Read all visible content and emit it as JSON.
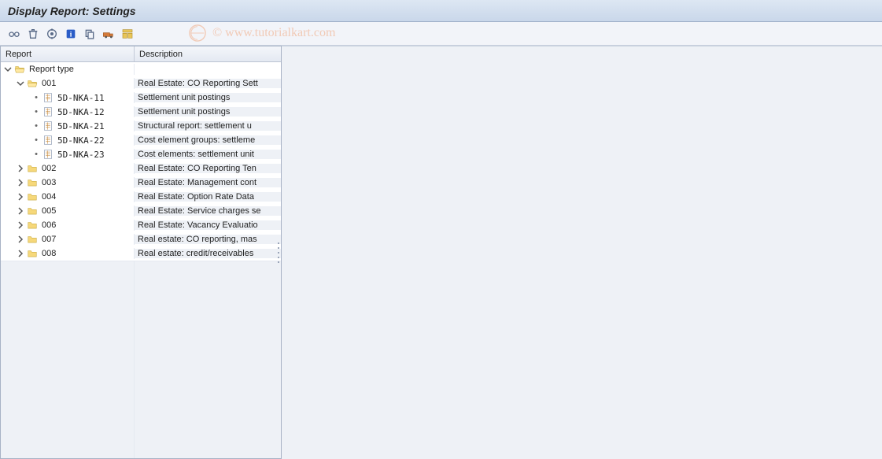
{
  "window": {
    "title": "Display Report: Settings"
  },
  "toolbar": {
    "items": [
      {
        "name": "glasses-icon",
        "title": "Display"
      },
      {
        "name": "trash-icon",
        "title": "Delete"
      },
      {
        "name": "execute-icon",
        "title": "Execute"
      },
      {
        "name": "info-icon",
        "title": "Information"
      },
      {
        "name": "copy-icon",
        "title": "Copy"
      },
      {
        "name": "transport-icon",
        "title": "Transport"
      },
      {
        "name": "layout-icon",
        "title": "Layout"
      }
    ]
  },
  "watermark": "© www.tutorialkart.com",
  "tree": {
    "cols": {
      "report": "Report",
      "description": "Description"
    },
    "root": {
      "label": "Report type",
      "desc": ""
    },
    "n001": {
      "label": "001",
      "desc": "Real Estate: CO Reporting Sett"
    },
    "leaves": [
      {
        "label": "5D-NKA-11",
        "desc": "Settlement unit postings"
      },
      {
        "label": "5D-NKA-12",
        "desc": "Settlement unit postings"
      },
      {
        "label": "5D-NKA-21",
        "desc": "Structural report: settlement u"
      },
      {
        "label": "5D-NKA-22",
        "desc": "Cost element groups: settleme"
      },
      {
        "label": "5D-NKA-23",
        "desc": "Cost elements: settlement unit"
      }
    ],
    "folders": [
      {
        "label": "002",
        "desc": "Real Estate: CO Reporting Ten"
      },
      {
        "label": "003",
        "desc": "Real Estate: Management cont"
      },
      {
        "label": "004",
        "desc": "Real Estate: Option Rate Data"
      },
      {
        "label": "005",
        "desc": "Real Estate: Service charges se"
      },
      {
        "label": "006",
        "desc": "Real Estate: Vacancy Evaluatio"
      },
      {
        "label": "007",
        "desc": "Real estate: CO reporting, mas"
      },
      {
        "label": "008",
        "desc": "Real estate: credit/receivables"
      }
    ]
  }
}
